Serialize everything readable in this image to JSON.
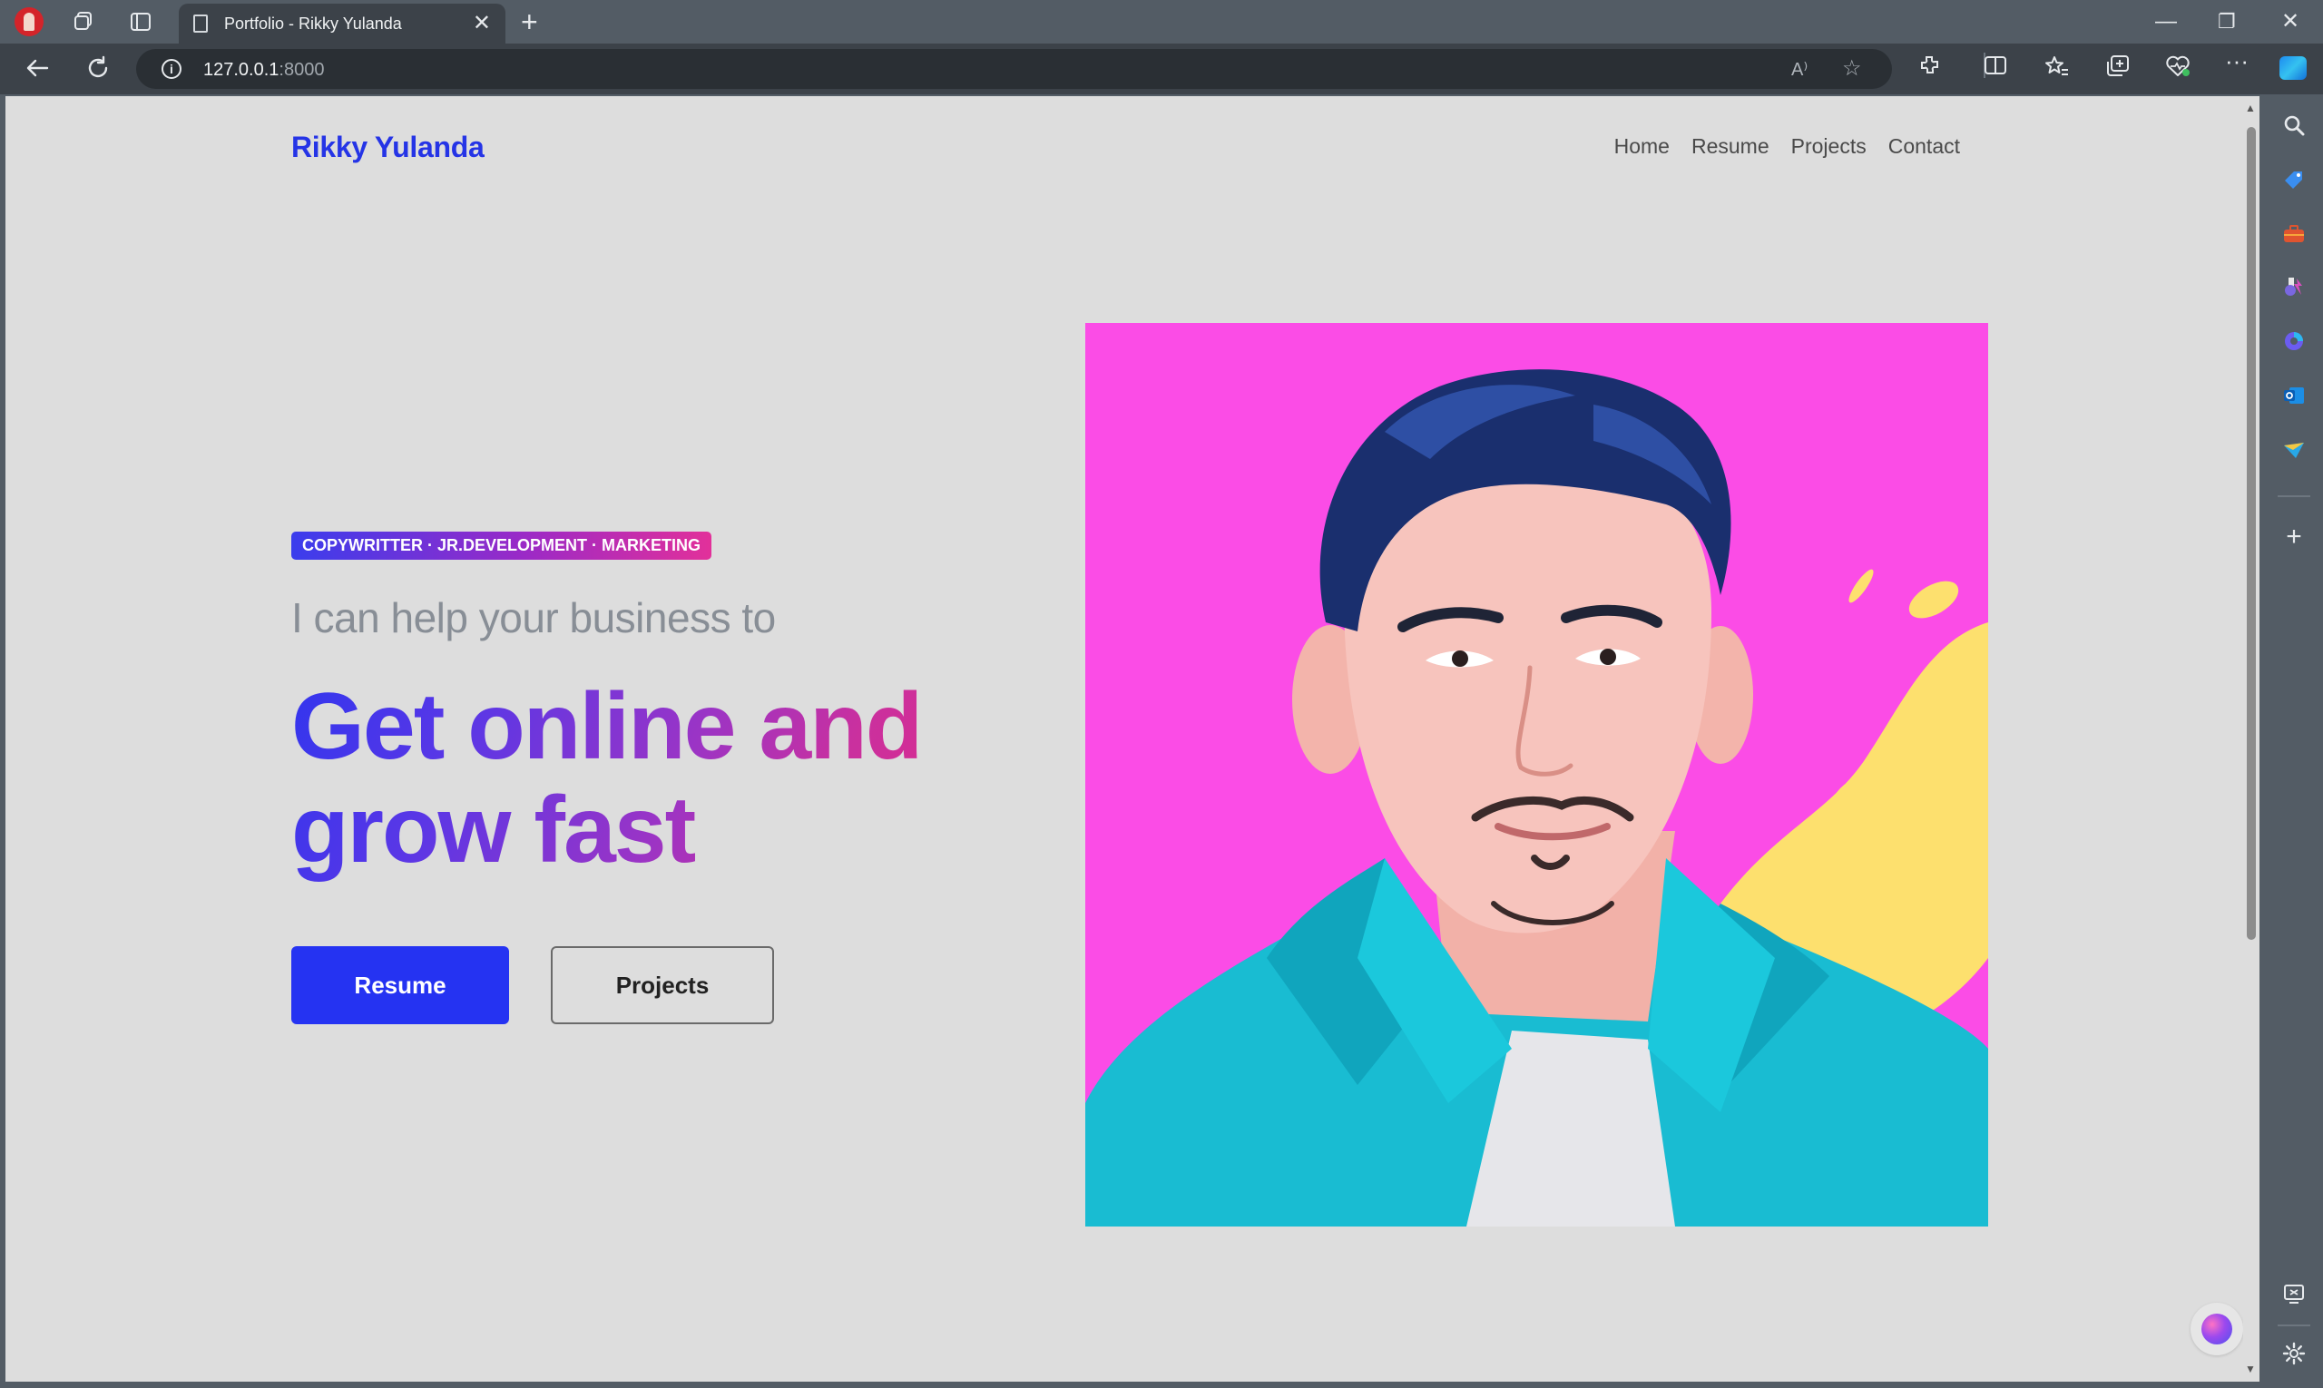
{
  "browser": {
    "tab_title": "Portfolio - Rikky Yulanda",
    "tab_close": "✕",
    "new_tab": "+",
    "url_host": "127.0.0.1",
    "url_port": ":8000",
    "read_aloud_label": "A⁾",
    "window_minimize": "—",
    "window_restore": "❐",
    "window_close": "✕"
  },
  "site": {
    "brand": "Rikky Yulanda",
    "nav": [
      "Home",
      "Resume",
      "Projects",
      "Contact"
    ]
  },
  "hero": {
    "badge": "COPYWRITTER · JR.DEVELOPMENT · MARKETING",
    "subtitle": "I can help your business to",
    "title_line1": "Get online and",
    "title_line2": "grow fast",
    "primary_button": "Resume",
    "secondary_button": "Projects"
  },
  "colors": {
    "brand_blue": "#2534e6",
    "button_blue": "#2533f2",
    "gradient_purple": "#9a34c6",
    "gradient_pink": "#e22a86",
    "page_background": "#dddddd",
    "portrait_background": "#fb4ce6",
    "portrait_splash": "#fde06e",
    "shirt_teal": "#19bcd2"
  },
  "icons": {
    "browser_chrome": [
      "profile-avatar",
      "workspaces-icon",
      "tab-actions-icon",
      "page-icon",
      "back-icon",
      "refresh-icon",
      "site-info-icon",
      "read-aloud-icon",
      "favorite-star-icon",
      "extensions-icon",
      "split-screen-icon",
      "favorites-icon",
      "collections-icon",
      "browser-essentials-icon",
      "more-icon",
      "copilot-icon"
    ],
    "sidebar": [
      "search-icon",
      "shopping-tag-icon",
      "tools-briefcase-icon",
      "games-icon",
      "copilot-sidebar-icon",
      "outlook-icon",
      "drop-icon",
      "add-icon",
      "screenshot-icon",
      "settings-icon"
    ],
    "page": [
      "floating-brain-icon"
    ]
  }
}
